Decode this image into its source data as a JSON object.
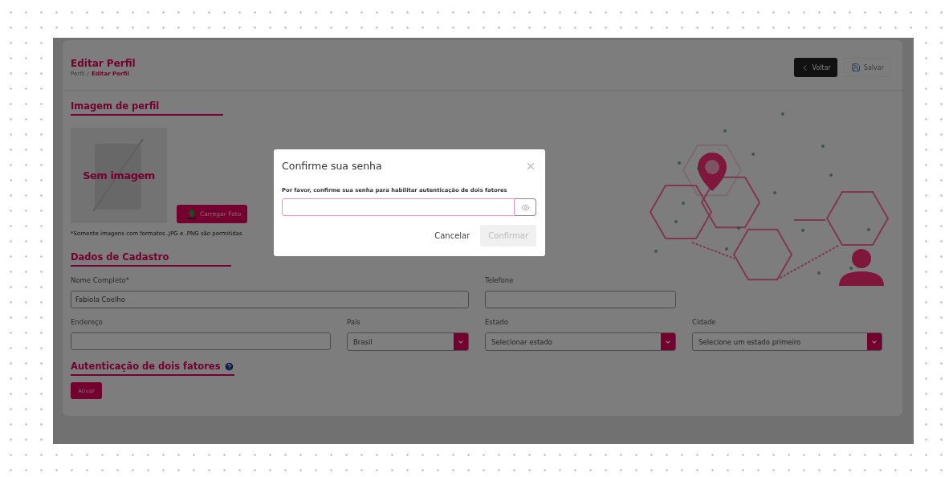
{
  "page": {
    "title": "Editar Perfil",
    "breadcrumb": [
      {
        "label": "Perfil",
        "current": false
      },
      {
        "label": "/",
        "current": false
      },
      {
        "label": "Editar Perfil",
        "current": true
      }
    ]
  },
  "header_buttons": [
    {
      "label": "Voltar",
      "kind": "back",
      "disabled": false
    },
    {
      "label": "Salvar",
      "kind": "save",
      "disabled": true
    }
  ],
  "profile_image": {
    "heading": "Imagem de perfil",
    "placeholder_text": "Sem imagem",
    "upload_button": "Carregar Foto",
    "note": "*Somente imagens com formatos .JPG e .PNG são permitidas"
  },
  "registration": {
    "heading": "Dados de Cadastro",
    "fields": [
      {
        "label": "Nome Completo*",
        "kind": "text",
        "value": "Fabiola Coelho"
      },
      {
        "label": "Telefone",
        "kind": "text"
      },
      {
        "label": "Endereço",
        "kind": "text"
      },
      {
        "label": "País",
        "kind": "select",
        "value": "Brasil"
      },
      {
        "label": "Estado",
        "kind": "select",
        "placeholder": "Selecionar estado"
      },
      {
        "label": "Cidade",
        "kind": "select",
        "placeholder": "Selecione um estado primeiro"
      }
    ]
  },
  "two_factor": {
    "heading": "Autenticação de dois fatores",
    "button": "Ativar"
  },
  "dialog": {
    "title": "Confirme sua senha",
    "message": "Por favor, confirme sua senha para habilitar autenticação de dois fatores",
    "password": {
      "focused": true
    },
    "buttons": [
      {
        "label": "Cancelar",
        "kind": "cancel",
        "disabled": false
      },
      {
        "label": "Confirmar",
        "kind": "confirm",
        "disabled": true
      }
    ]
  }
}
